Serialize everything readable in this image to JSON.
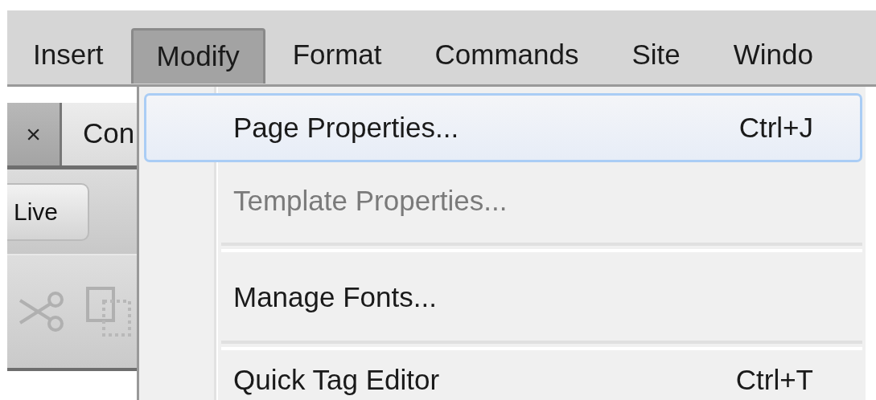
{
  "menu_bar": [
    {
      "label": "Insert",
      "selected": false
    },
    {
      "label": "Modify",
      "selected": true
    },
    {
      "label": "Format",
      "selected": false
    },
    {
      "label": "Commands",
      "selected": false
    },
    {
      "label": "Site",
      "selected": false
    },
    {
      "label": "Windo",
      "selected": false
    }
  ],
  "document_tabs": [
    {
      "kind": "close",
      "label": "×"
    },
    {
      "kind": "tab",
      "label": "Con"
    }
  ],
  "toolbar": {
    "live_button": "Live"
  },
  "menu": {
    "items": [
      {
        "kind": "item",
        "label": "Page Properties...",
        "shortcut": "Ctrl+J",
        "selected": true,
        "disabled": false
      },
      {
        "kind": "item",
        "label": "Template Properties...",
        "selected": false,
        "disabled": true
      },
      {
        "kind": "separator"
      },
      {
        "kind": "item",
        "label": "Manage Fonts...",
        "selected": false,
        "disabled": false
      },
      {
        "kind": "separator"
      },
      {
        "kind": "item",
        "label": "Quick Tag Editor",
        "shortcut": "Ctrl+T",
        "selected": false,
        "disabled": false
      }
    ]
  }
}
